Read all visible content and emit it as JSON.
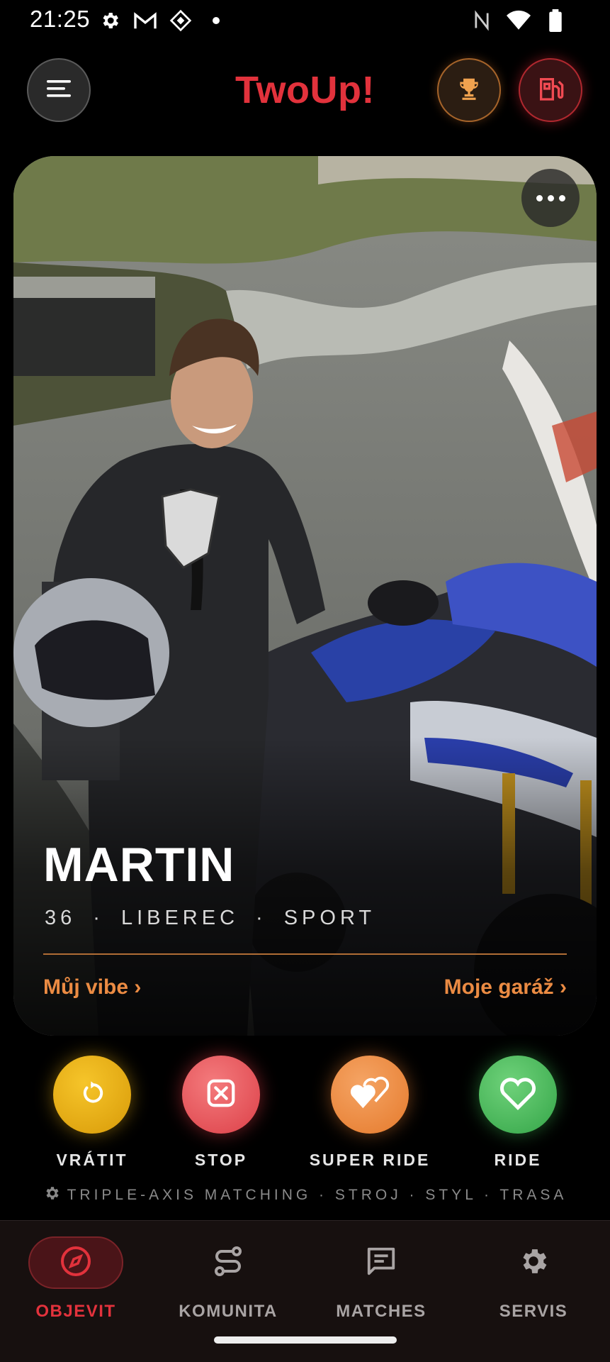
{
  "status_bar": {
    "time": "21:25",
    "left_icons": [
      "gear-icon",
      "gmail-icon",
      "app-icon",
      "notification-dot-icon"
    ],
    "right_icons": [
      "nfc-icon",
      "wifi-icon",
      "battery-icon"
    ]
  },
  "header": {
    "title": "TwoUp!",
    "menu_icon": "menu-icon",
    "trophy_icon": "trophy-icon",
    "garage_icon": "fuel-pump-icon"
  },
  "card": {
    "name": "MARTIN",
    "age": "36",
    "city": "LIBEREC",
    "style": "SPORT",
    "separator": "·",
    "link_left": "Můj vibe ›",
    "link_right": "Moje garáž ›",
    "more_icon": "more-horizontal-icon"
  },
  "actions": [
    {
      "label": "VRÁTIT",
      "icon": "undo-icon",
      "color": "#e8ad14"
    },
    {
      "label": "STOP",
      "icon": "close-box-icon",
      "color": "#e4545a"
    },
    {
      "label": "SUPER RIDE",
      "icon": "double-heart-icon",
      "color": "#ec8a3e"
    },
    {
      "label": "RIDE",
      "icon": "heart-icon",
      "color": "#46b556"
    }
  ],
  "tagline": "TRIPLE-AXIS MATCHING · STROJ · STYL · TRASA",
  "bottom_nav": [
    {
      "label": "OBJEVIT",
      "icon": "compass-icon",
      "active": true
    },
    {
      "label": "KOMUNITA",
      "icon": "route-icon",
      "active": false
    },
    {
      "label": "MATCHES",
      "icon": "chat-icon",
      "active": false
    },
    {
      "label": "SERVIS",
      "icon": "gear-icon",
      "active": false
    }
  ],
  "colors": {
    "brand": "#e2323c",
    "accent_orange": "#eb8b43",
    "background": "#000000"
  }
}
